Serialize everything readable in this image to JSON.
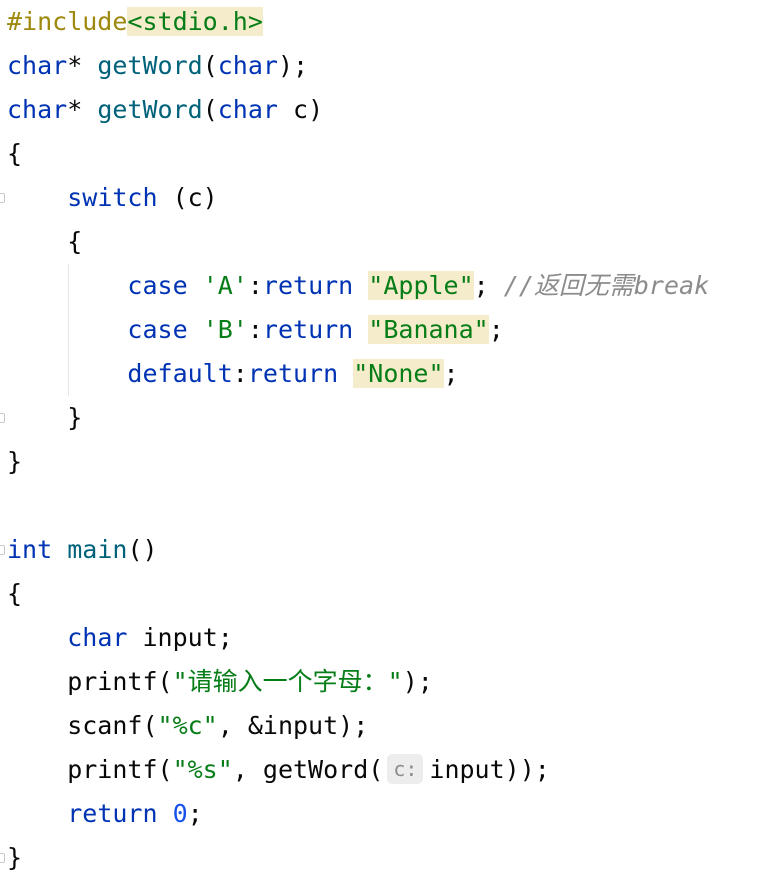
{
  "editor": {
    "lines": [
      {
        "tokens": [
          {
            "t": "pp",
            "v": "#include"
          },
          {
            "t": "str hl",
            "v": "<stdio.h>"
          }
        ]
      },
      {
        "tokens": [
          {
            "t": "kw",
            "v": "char"
          },
          {
            "t": "plain",
            "v": "* "
          },
          {
            "t": "fn",
            "v": "getWord"
          },
          {
            "t": "plain",
            "v": "("
          },
          {
            "t": "kw",
            "v": "char"
          },
          {
            "t": "plain",
            "v": ");"
          }
        ]
      },
      {
        "tokens": [
          {
            "t": "kw",
            "v": "char"
          },
          {
            "t": "plain",
            "v": "* "
          },
          {
            "t": "fn",
            "v": "getWord"
          },
          {
            "t": "plain",
            "v": "("
          },
          {
            "t": "kw",
            "v": "char"
          },
          {
            "t": "plain",
            "v": " c)"
          }
        ]
      },
      {
        "tokens": [
          {
            "t": "plain",
            "v": "{"
          }
        ]
      },
      {
        "tokens": [
          {
            "t": "plain",
            "v": "    "
          },
          {
            "t": "kw",
            "v": "switch"
          },
          {
            "t": "plain",
            "v": " (c)"
          }
        ]
      },
      {
        "tokens": [
          {
            "t": "plain",
            "v": "    {"
          }
        ]
      },
      {
        "tokens": [
          {
            "t": "plain",
            "v": "        "
          },
          {
            "t": "kw",
            "v": "case"
          },
          {
            "t": "plain",
            "v": " "
          },
          {
            "t": "str",
            "v": "'A'"
          },
          {
            "t": "plain",
            "v": ":"
          },
          {
            "t": "kw",
            "v": "return"
          },
          {
            "t": "plain",
            "v": " "
          },
          {
            "t": "str hl",
            "v": "\"Apple\""
          },
          {
            "t": "plain",
            "v": "; "
          },
          {
            "t": "cmt",
            "v": "//返回无需break"
          }
        ]
      },
      {
        "tokens": [
          {
            "t": "plain",
            "v": "        "
          },
          {
            "t": "kw",
            "v": "case"
          },
          {
            "t": "plain",
            "v": " "
          },
          {
            "t": "str",
            "v": "'B'"
          },
          {
            "t": "plain",
            "v": ":"
          },
          {
            "t": "kw",
            "v": "return"
          },
          {
            "t": "plain",
            "v": " "
          },
          {
            "t": "str hl",
            "v": "\"Banana\""
          },
          {
            "t": "plain",
            "v": ";"
          }
        ]
      },
      {
        "tokens": [
          {
            "t": "plain",
            "v": "        "
          },
          {
            "t": "kw",
            "v": "default"
          },
          {
            "t": "plain",
            "v": ":"
          },
          {
            "t": "kw",
            "v": "return"
          },
          {
            "t": "plain",
            "v": " "
          },
          {
            "t": "str hl",
            "v": "\"None\""
          },
          {
            "t": "plain",
            "v": ";"
          }
        ]
      },
      {
        "tokens": [
          {
            "t": "plain",
            "v": "    }"
          }
        ]
      },
      {
        "tokens": [
          {
            "t": "plain",
            "v": "}"
          }
        ]
      },
      {
        "tokens": []
      },
      {
        "tokens": [
          {
            "t": "kw",
            "v": "int"
          },
          {
            "t": "plain",
            "v": " "
          },
          {
            "t": "fn",
            "v": "main"
          },
          {
            "t": "plain",
            "v": "()"
          }
        ]
      },
      {
        "tokens": [
          {
            "t": "plain",
            "v": "{"
          }
        ]
      },
      {
        "tokens": [
          {
            "t": "plain",
            "v": "    "
          },
          {
            "t": "kw",
            "v": "char"
          },
          {
            "t": "plain",
            "v": " input;"
          }
        ]
      },
      {
        "tokens": [
          {
            "t": "plain",
            "v": "    printf("
          },
          {
            "t": "str",
            "v": "\"请输入一个字母：\""
          },
          {
            "t": "plain",
            "v": ");"
          }
        ]
      },
      {
        "tokens": [
          {
            "t": "plain",
            "v": "    scanf("
          },
          {
            "t": "str",
            "v": "\"%c\""
          },
          {
            "t": "plain",
            "v": ", &input);"
          }
        ]
      },
      {
        "tokens": [
          {
            "t": "plain",
            "v": "    printf("
          },
          {
            "t": "str",
            "v": "\"%s\""
          },
          {
            "t": "plain",
            "v": ", getWord("
          },
          {
            "t": "hint",
            "v": "c:"
          },
          {
            "t": "plain",
            "v": "input));"
          }
        ]
      },
      {
        "tokens": [
          {
            "t": "plain",
            "v": "    "
          },
          {
            "t": "kw",
            "v": "return"
          },
          {
            "t": "plain",
            "v": " "
          },
          {
            "t": "num",
            "v": "0"
          },
          {
            "t": "plain",
            "v": ";"
          }
        ]
      },
      {
        "tokens": [
          {
            "t": "plain",
            "v": "}"
          }
        ]
      }
    ]
  },
  "colors": {
    "background": "#ffffff",
    "keyword": "#0033b3",
    "function": "#00627a",
    "string": "#067d17",
    "number": "#1750eb",
    "preprocessor": "#9e880d",
    "comment": "#8c8c8c",
    "highlight": "#f5eccb"
  }
}
